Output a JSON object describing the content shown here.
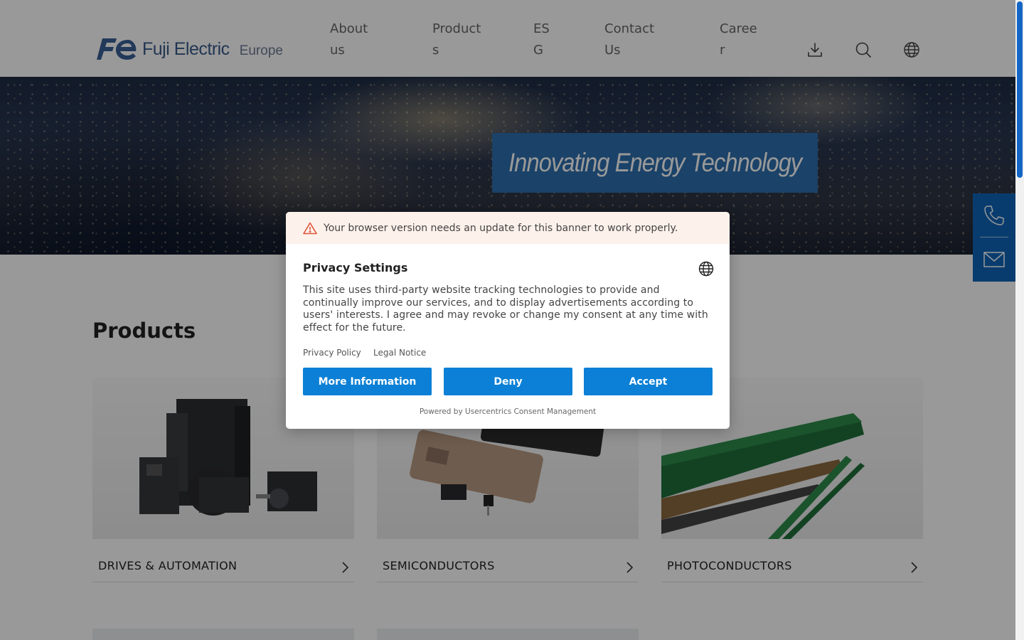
{
  "header": {
    "logo_text": "Fuji Electric",
    "logo_region": "Europe",
    "nav": [
      "About us",
      "Products",
      "ESG",
      "Contact Us",
      "Career"
    ],
    "icons": [
      "download-icon",
      "search-icon",
      "globe-icon"
    ]
  },
  "hero": {
    "tagline": "Innovating Energy Technology"
  },
  "side_contact": {
    "icons": [
      "phone-icon",
      "mail-icon"
    ],
    "color": "#0f65b8"
  },
  "products": {
    "title": "Products",
    "cards": [
      {
        "label": "DRIVES & AUTOMATION"
      },
      {
        "label": "SEMICONDUCTORS"
      },
      {
        "label": "PHOTOCONDUCTORS"
      }
    ]
  },
  "consent": {
    "warning": "Your browser version needs an update for this banner to work properly.",
    "title": "Privacy Settings",
    "body": "This site uses third-party website tracking technologies to provide and continually improve our services, and to display advertisements according to users' interests. I agree and may revoke or change my consent at any time with effect for the future.",
    "links": [
      "Privacy Policy",
      "Legal Notice"
    ],
    "buttons": {
      "more": "More Information",
      "deny": "Deny",
      "accept": "Accept"
    },
    "powered_by": "Powered by Usercentrics Consent Management",
    "button_color": "#0b80d6",
    "warning_bg": "#fdf1eb"
  },
  "colors": {
    "brand_blue": "#2e6fae",
    "scroll_thumb": "#1466c4"
  }
}
